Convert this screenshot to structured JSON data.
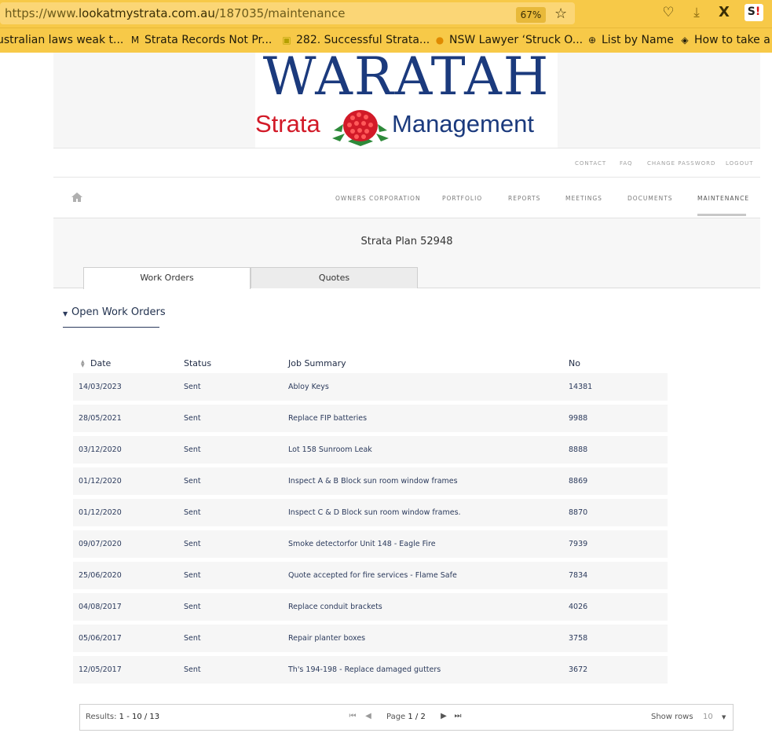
{
  "browser": {
    "url_prefix": "https://www.",
    "url_host": "lookatmystrata.com.au",
    "url_path": "/187035/maintenance",
    "zoom": "67%",
    "icons": [
      "star-icon",
      "pocket-icon",
      "download-icon",
      "x-icon",
      "extension-icon"
    ],
    "extension_label": "S",
    "extension_mark": "!",
    "bookmarks": [
      {
        "label": "ustralian laws weak t...",
        "icon": ""
      },
      {
        "label": "Strata Records Not Pr...",
        "icon": "M"
      },
      {
        "label": "282. Successful Strata...",
        "icon": "▣"
      },
      {
        "label": "NSW Lawyer ‘Struck O...",
        "icon": "●"
      },
      {
        "label": "List by Name",
        "icon": "⊕"
      },
      {
        "label": "How to take a s",
        "icon": "◈"
      }
    ]
  },
  "logo": {
    "title": "WARATAH",
    "left_word": "Strata",
    "right_word": "Management",
    "colors": {
      "blue": "#1b3a7d",
      "red": "#d21a28",
      "green": "#2e8a3a"
    }
  },
  "utility_nav": [
    "CONTACT",
    "FAQ",
    "CHANGE PASSWORD",
    "LOGOUT"
  ],
  "main_nav": {
    "home_icon": "home-icon",
    "items": [
      "OWNERS CORPORATION",
      "PORTFOLIO",
      "REPORTS",
      "MEETINGS",
      "DOCUMENTS",
      "MAINTENANCE"
    ],
    "active": "MAINTENANCE"
  },
  "plan_title": "Strata Plan 52948",
  "tabs": [
    {
      "label": "Work Orders",
      "active": true
    },
    {
      "label": "Quotes",
      "active": false
    }
  ],
  "section": {
    "title": "Open Work Orders",
    "icon": "caret-down-icon"
  },
  "table": {
    "columns": [
      "Date",
      "Status",
      "Job Summary",
      "No"
    ],
    "rows": [
      {
        "date": "14/03/2023",
        "status": "Sent",
        "summary": "Abloy Keys",
        "no": "14381"
      },
      {
        "date": "28/05/2021",
        "status": "Sent",
        "summary": "Replace FIP batteries",
        "no": "9988"
      },
      {
        "date": "03/12/2020",
        "status": "Sent",
        "summary": "Lot 158 Sunroom Leak",
        "no": "8888"
      },
      {
        "date": "01/12/2020",
        "status": "Sent",
        "summary": "Inspect A & B Block sun room window frames",
        "no": "8869"
      },
      {
        "date": "01/12/2020",
        "status": "Sent",
        "summary": "Inspect C & D Block sun room window frames.",
        "no": "8870"
      },
      {
        "date": "09/07/2020",
        "status": "Sent",
        "summary": "Smoke detectorfor Unit 148 - Eagle Fire",
        "no": "7939"
      },
      {
        "date": "25/06/2020",
        "status": "Sent",
        "summary": "Quote accepted for fire services - Flame Safe",
        "no": "7834"
      },
      {
        "date": "04/08/2017",
        "status": "Sent",
        "summary": "Replace conduit brackets",
        "no": "4026"
      },
      {
        "date": "05/06/2017",
        "status": "Sent",
        "summary": "Repair planter boxes",
        "no": "3758"
      },
      {
        "date": "12/05/2017",
        "status": "Sent",
        "summary": "Th's 194-198 - Replace damaged gutters",
        "no": "3672"
      }
    ]
  },
  "pager": {
    "results_label": "Results: ",
    "results_value": "1 - 10 / 13",
    "page_label": "Page ",
    "page_value": "1 / 2",
    "show_rows_label": "Show rows",
    "rows_value": "10"
  }
}
